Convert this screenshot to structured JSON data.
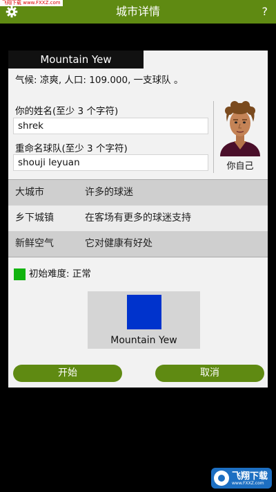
{
  "watermark": "飞翔下载 www.FXXZ.com",
  "header": {
    "title": "城市详情",
    "help": "?"
  },
  "city": {
    "name": "Mountain Yew",
    "info": "气候: 凉爽, 人口: 109.000, 一支球队 。"
  },
  "form": {
    "name_label": "你的姓名(至少 3 个字符)",
    "name_value": "shrek",
    "team_label": "重命名球队(至少 3 个字符)",
    "team_value": "shouji leyuan"
  },
  "avatar_caption": "你自己",
  "traits": [
    {
      "name": "大城市",
      "desc": "许多的球迷"
    },
    {
      "name": "乡下城镇",
      "desc": "在客场有更多的球迷支持"
    },
    {
      "name": "新鲜空气",
      "desc": "它对健康有好处"
    }
  ],
  "difficulty": {
    "text": "初始难度: 正常",
    "color": "#11b30f"
  },
  "flag": {
    "color": "#0033cc",
    "label": "Mountain Yew"
  },
  "buttons": {
    "start": "开始",
    "cancel": "取消"
  },
  "logo": {
    "name": "飞翔下载",
    "url": "www.FXXZ.com"
  },
  "colors": {
    "accent": "#5f8a12"
  }
}
